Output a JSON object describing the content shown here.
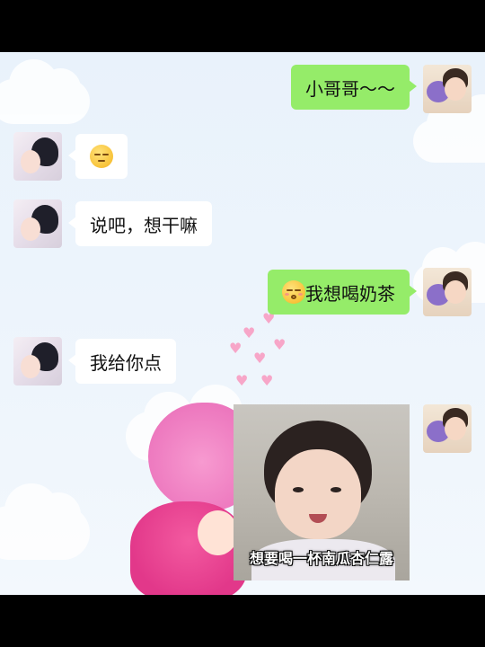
{
  "messages": [
    {
      "side": "right",
      "text": "小哥哥～～"
    },
    {
      "side": "left",
      "emoji": "unamused-face-icon"
    },
    {
      "side": "left",
      "text": "说吧，想干嘛"
    },
    {
      "side": "right",
      "emoji": "kissing-face-icon",
      "text": "我想喝奶茶"
    },
    {
      "side": "left",
      "text": "我给你点"
    },
    {
      "side": "right",
      "image_caption": "想要喝一杯南瓜杏仁露"
    }
  ],
  "colors": {
    "outgoing_bubble": "#95ec69",
    "incoming_bubble": "#ffffff",
    "background": "#eef5fc"
  }
}
